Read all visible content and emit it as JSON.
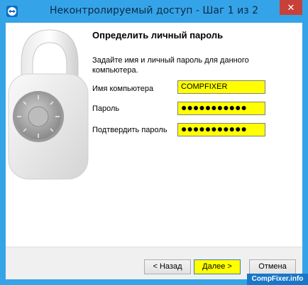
{
  "window": {
    "title": "Неконтролируемый доступ - Шаг 1 из 2",
    "close_glyph": "✕"
  },
  "page": {
    "heading": "Определить личный пароль",
    "description": "Задайте имя и личный пароль для данного компьютера."
  },
  "form": {
    "computer_name_label": "Имя компьютера",
    "computer_name_value": "COMPFIXER",
    "password_label": "Пароль",
    "password_value": "●●●●●●●●●●●",
    "confirm_label": "Подтвердить пароль",
    "confirm_value": "●●●●●●●●●●●"
  },
  "buttons": {
    "back": "< Назад",
    "next": "Далее >",
    "cancel": "Отмена"
  },
  "watermark": "CompFixer.info",
  "colors": {
    "titlebar": "#35a3e8",
    "highlight": "#ffff00",
    "close": "#c7413a"
  },
  "icons": {
    "app": "teamviewer-icon",
    "lock": "padlock-icon"
  }
}
